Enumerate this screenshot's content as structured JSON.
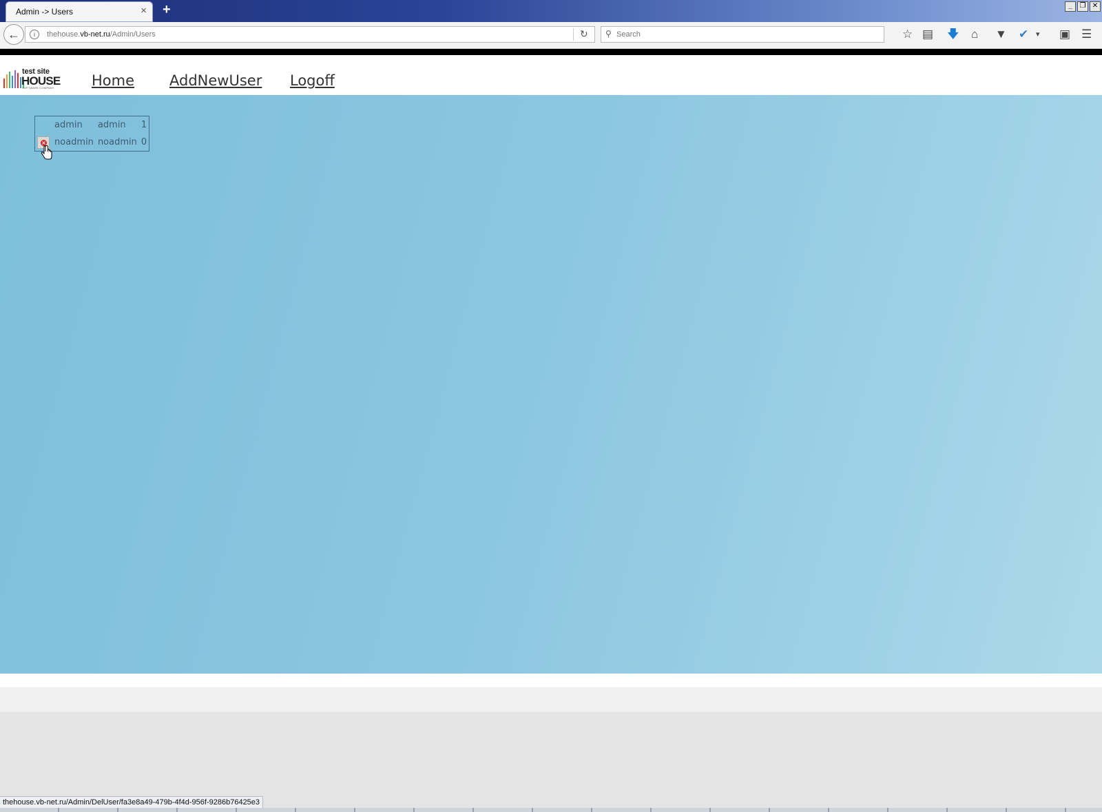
{
  "browser": {
    "tab_title": "Admin -> Users",
    "tab_close_glyph": "×",
    "new_tab_glyph": "+",
    "window_buttons": [
      "_",
      "❐",
      "✕"
    ],
    "url_domain_prefix": "thehouse.",
    "url_domain": "vb-net.ru",
    "url_path": "/Admin/Users",
    "search_placeholder": "Search",
    "toolbar_icons": [
      "star-icon",
      "reading-list-icon",
      "download-icon",
      "home-icon",
      "pocket-icon",
      "sync-icon",
      "chat-icon",
      "menu-icon"
    ]
  },
  "site": {
    "logo_top": "test site",
    "logo_main": "HOUSE",
    "logo_sub": "SOFTWARE COMPANY",
    "logo_bar_colors": [
      "#e3342f",
      "#f6993f",
      "#38c172",
      "#3490dc",
      "#9561e2",
      "#e3342f",
      "#3490dc",
      "#38c172"
    ],
    "nav": [
      {
        "label": "Home"
      },
      {
        "label": "AddNewUser"
      },
      {
        "label": "Logoff"
      }
    ]
  },
  "users": {
    "rows": [
      {
        "name": "admin",
        "login": "admin",
        "is_admin": "1",
        "has_delete": false
      },
      {
        "name": "noadmin",
        "login": "noadmin",
        "is_admin": "0",
        "has_delete": true
      }
    ],
    "delete_icon": "delete-x-icon"
  },
  "status_bar": {
    "url": "thehouse.vb-net.ru/Admin/DelUser/fa3e8a49-479b-4f4d-956f-9286b76425e3"
  },
  "colors": {
    "main_background": "#8ac6df",
    "table_border": "#3e6f8e",
    "delete_icon": "#d42727"
  }
}
